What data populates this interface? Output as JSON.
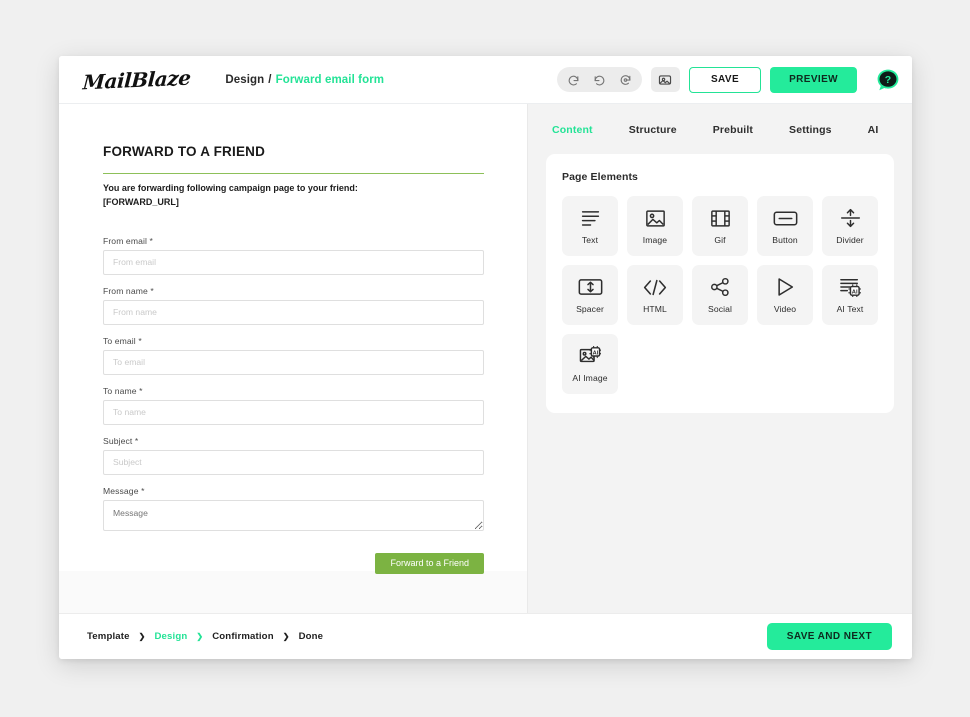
{
  "app": {
    "brand": "MailBlaze",
    "breadcrumb_top": {
      "section": "Design",
      "separator": "/",
      "current": "Forward email form"
    },
    "accent_color": "#23e396",
    "preview_color": "#24eb9b",
    "form_button_color": "#7cb342"
  },
  "toolbar": {
    "undo_icon": "undo-icon",
    "redo_icon": "redo-icon",
    "history_icon": "history-restore-icon",
    "image_toggle_icon": "image-preview-icon",
    "save_label": "SAVE",
    "preview_label": "PREVIEW",
    "help_icon": "help-question-bubble-icon"
  },
  "canvas": {
    "title": "FORWARD TO A FRIEND",
    "intro_line_1": "You are forwarding following campaign page to your friend:",
    "intro_line_2": "[FORWARD_URL]",
    "fields": [
      {
        "label": "From email",
        "required": "*",
        "placeholder": "From email",
        "value": "",
        "type": "input",
        "name": "from-email"
      },
      {
        "label": "From name",
        "required": "*",
        "placeholder": "From name",
        "value": "",
        "type": "input",
        "name": "from-name"
      },
      {
        "label": "To email",
        "required": "*",
        "placeholder": "To email",
        "value": "",
        "type": "input",
        "name": "to-email"
      },
      {
        "label": "To name",
        "required": "*",
        "placeholder": "To name",
        "value": "",
        "type": "input",
        "name": "to-name"
      },
      {
        "label": "Subject",
        "required": "*",
        "placeholder": "Subject",
        "value": "",
        "type": "input",
        "name": "subject"
      },
      {
        "label": "Message",
        "required": "*",
        "placeholder": "Message",
        "value": "",
        "type": "textarea",
        "name": "message"
      }
    ],
    "submit_label": "Forward to a Friend"
  },
  "right_panel": {
    "tabs": [
      {
        "label": "Content",
        "active": true
      },
      {
        "label": "Structure",
        "active": false
      },
      {
        "label": "Prebuilt",
        "active": false
      },
      {
        "label": "Settings",
        "active": false
      },
      {
        "label": "AI",
        "active": false
      }
    ],
    "section_title": "Page Elements",
    "elements": [
      {
        "label": "Text",
        "icon": "text-lines-icon"
      },
      {
        "label": "Image",
        "icon": "image-icon"
      },
      {
        "label": "Gif",
        "icon": "film-strip-icon"
      },
      {
        "label": "Button",
        "icon": "button-icon"
      },
      {
        "label": "Divider",
        "icon": "divider-arrows-icon"
      },
      {
        "label": "Spacer",
        "icon": "spacer-arrows-icon"
      },
      {
        "label": "HTML",
        "icon": "code-brackets-icon"
      },
      {
        "label": "Social",
        "icon": "share-nodes-icon"
      },
      {
        "label": "Video",
        "icon": "play-triangle-icon"
      },
      {
        "label": "AI Text",
        "icon": "ai-text-chip-icon"
      },
      {
        "label": "AI Image",
        "icon": "ai-image-chip-icon"
      }
    ]
  },
  "footer": {
    "steps": [
      {
        "label": "Template",
        "active": false
      },
      {
        "label": "Design",
        "active": true
      },
      {
        "label": "Confirmation",
        "active": false
      },
      {
        "label": "Done",
        "active": false
      }
    ],
    "separator": "❯",
    "save_next_label": "SAVE AND NEXT"
  }
}
